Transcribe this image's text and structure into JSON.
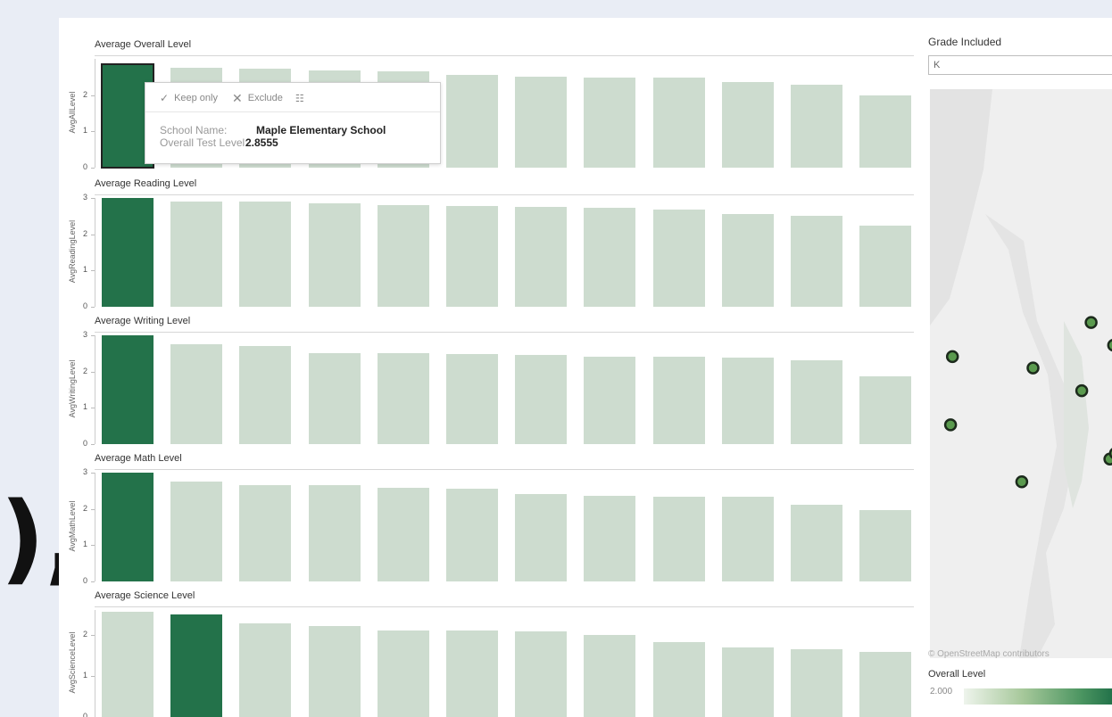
{
  "colors": {
    "selected_bar": "#23724a",
    "other_bar": "#cddccf",
    "map_point": "#5a9a4e",
    "map_point_outline": "#1c2a1c"
  },
  "chart_data": [
    {
      "type": "bar",
      "title": "Average Overall Level",
      "ylabel": "AvgAllLevel",
      "yticks": [
        "0",
        "1",
        "2"
      ],
      "ylim": [
        0,
        3
      ],
      "values": [
        2.8555,
        2.75,
        2.72,
        2.68,
        2.65,
        2.55,
        2.52,
        2.48,
        2.48,
        2.37,
        2.28,
        2.0
      ],
      "selected_index": 0
    },
    {
      "type": "bar",
      "title": "Average Reading Level",
      "ylabel": "AvgReadingLevel",
      "yticks": [
        "0",
        "1",
        "2",
        "3"
      ],
      "ylim": [
        0,
        3
      ],
      "values": [
        3.0,
        2.9,
        2.9,
        2.85,
        2.8,
        2.78,
        2.75,
        2.72,
        2.68,
        2.55,
        2.52,
        2.25
      ],
      "selected_index": 0
    },
    {
      "type": "bar",
      "title": "Average Writing Level",
      "ylabel": "AvgWritingLevel",
      "yticks": [
        "0",
        "1",
        "2",
        "3"
      ],
      "ylim": [
        0,
        3
      ],
      "values": [
        3.0,
        2.75,
        2.7,
        2.5,
        2.5,
        2.48,
        2.45,
        2.42,
        2.4,
        2.38,
        2.32,
        1.88
      ],
      "selected_index": 0
    },
    {
      "type": "bar",
      "title": "Average Math Level",
      "ylabel": "AvgMathLevel",
      "yticks": [
        "0",
        "1",
        "2",
        "3"
      ],
      "ylim": [
        0,
        3
      ],
      "values": [
        3.0,
        2.75,
        2.65,
        2.65,
        2.58,
        2.55,
        2.4,
        2.35,
        2.33,
        2.33,
        2.12,
        1.97
      ],
      "selected_index": 0
    },
    {
      "type": "bar",
      "title": "Average Science Level",
      "ylabel": "AvgScienceLevel",
      "yticks": [
        "0",
        "1",
        "2"
      ],
      "ylim": [
        0,
        2.6
      ],
      "values": [
        2.55,
        2.5,
        2.28,
        2.2,
        2.1,
        2.1,
        2.08,
        2.0,
        1.83,
        1.7,
        1.64,
        1.58
      ],
      "selected_index": 1
    }
  ],
  "decor": {
    "big_mark": "),"
  },
  "tooltip": {
    "keep_only": "Keep only",
    "exclude": "Exclude",
    "school_name_label": "School Name:",
    "school_name_value": "Maple Elementary School",
    "level_label": "Overall Test Level:",
    "level_value": "2.8555"
  },
  "filter": {
    "title": "Grade Included",
    "value": "K"
  },
  "map": {
    "credit": "© OpenStreetMap contributors",
    "points": [
      {
        "x": 0.86,
        "y": 0.41
      },
      {
        "x": 0.98,
        "y": 0.45
      },
      {
        "x": 0.12,
        "y": 0.47
      },
      {
        "x": 0.55,
        "y": 0.49
      },
      {
        "x": 0.81,
        "y": 0.53
      },
      {
        "x": 0.11,
        "y": 0.59
      },
      {
        "x": 0.96,
        "y": 0.65
      },
      {
        "x": 0.99,
        "y": 0.64
      },
      {
        "x": 0.49,
        "y": 0.69
      }
    ]
  },
  "legend": {
    "title": "Overall Level",
    "min_label": "2.000"
  }
}
